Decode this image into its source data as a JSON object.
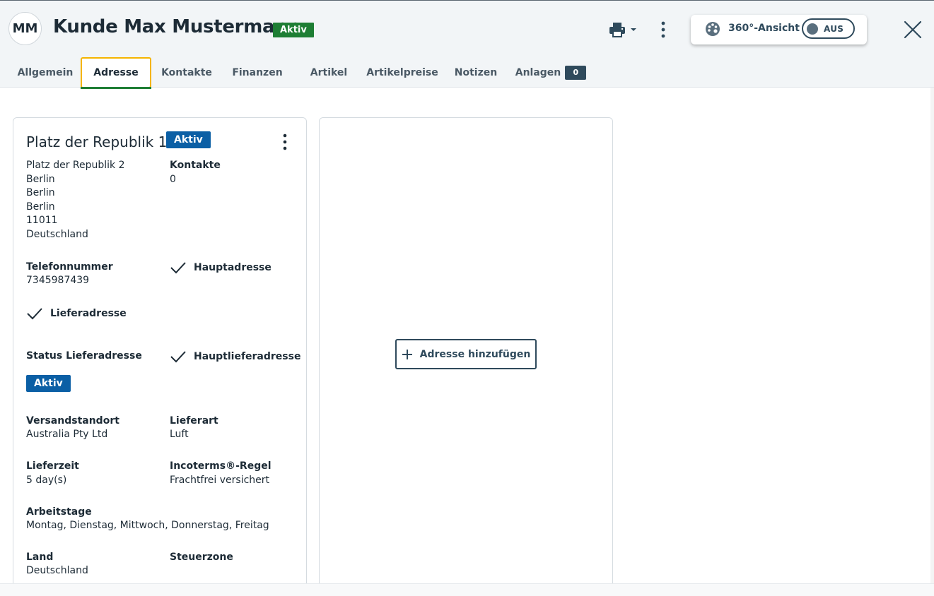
{
  "header": {
    "avatar_initials": "MM",
    "title": "Kunde Max Mustermann",
    "status_badge": "Aktiv",
    "view360": {
      "label": "360°-Ansicht",
      "toggle_state": "AUS"
    }
  },
  "tabs": [
    {
      "label": "Allgemein"
    },
    {
      "label": "Adresse",
      "active": true
    },
    {
      "label": "Kontakte"
    },
    {
      "label": "Finanzen"
    },
    {
      "label": "Artikel"
    },
    {
      "label": "Artikelpreise"
    },
    {
      "label": "Notizen"
    },
    {
      "label": "Anlagen",
      "count": "0"
    }
  ],
  "address_card": {
    "title": "Platz der Republik 1",
    "status": "Aktiv",
    "address_lines": [
      "Platz der Republik 2",
      "Berlin",
      "Berlin",
      "Berlin",
      "11011",
      "Deutschland"
    ],
    "contacts_label": "Kontakte",
    "contacts_value": "0",
    "phone_label": "Telefonnummer",
    "phone_value": "7345987439",
    "main_address_label": "Hauptadresse",
    "delivery_address_label": "Lieferadresse",
    "delivery_status_label": "Status Lieferadresse",
    "delivery_status_value": "Aktiv",
    "main_delivery_address_label": "Hauptlieferadresse",
    "shipping_location_label": "Versandstandort",
    "shipping_location_value": "Australia Pty Ltd",
    "delivery_type_label": "Lieferart",
    "delivery_type_value": "Luft",
    "delivery_time_label": "Lieferzeit",
    "delivery_time_value": "5 day(s)",
    "incoterms_label": "Incoterms®-Regel",
    "incoterms_value": "Frachtfrei versichert",
    "workdays_label": "Arbeitstage",
    "workdays_value": "Montag, Dienstag, Mittwoch, Donnerstag, Freitag",
    "country_label": "Land",
    "country_value": "Deutschland",
    "tax_zone_label": "Steuerzone"
  },
  "add_address_label": "Adresse hinzufügen",
  "icons": {
    "print": "printer-icon",
    "more": "more-vertical-icon",
    "view360": "palette-icon",
    "close": "close-icon",
    "check": "check-icon",
    "add": "plus-icon"
  },
  "colors": {
    "green_badge": "#1e7e34",
    "blue_badge": "#0b5fa5",
    "tab_focus": "#f5b400",
    "primary_dark": "#2f4a5c"
  }
}
